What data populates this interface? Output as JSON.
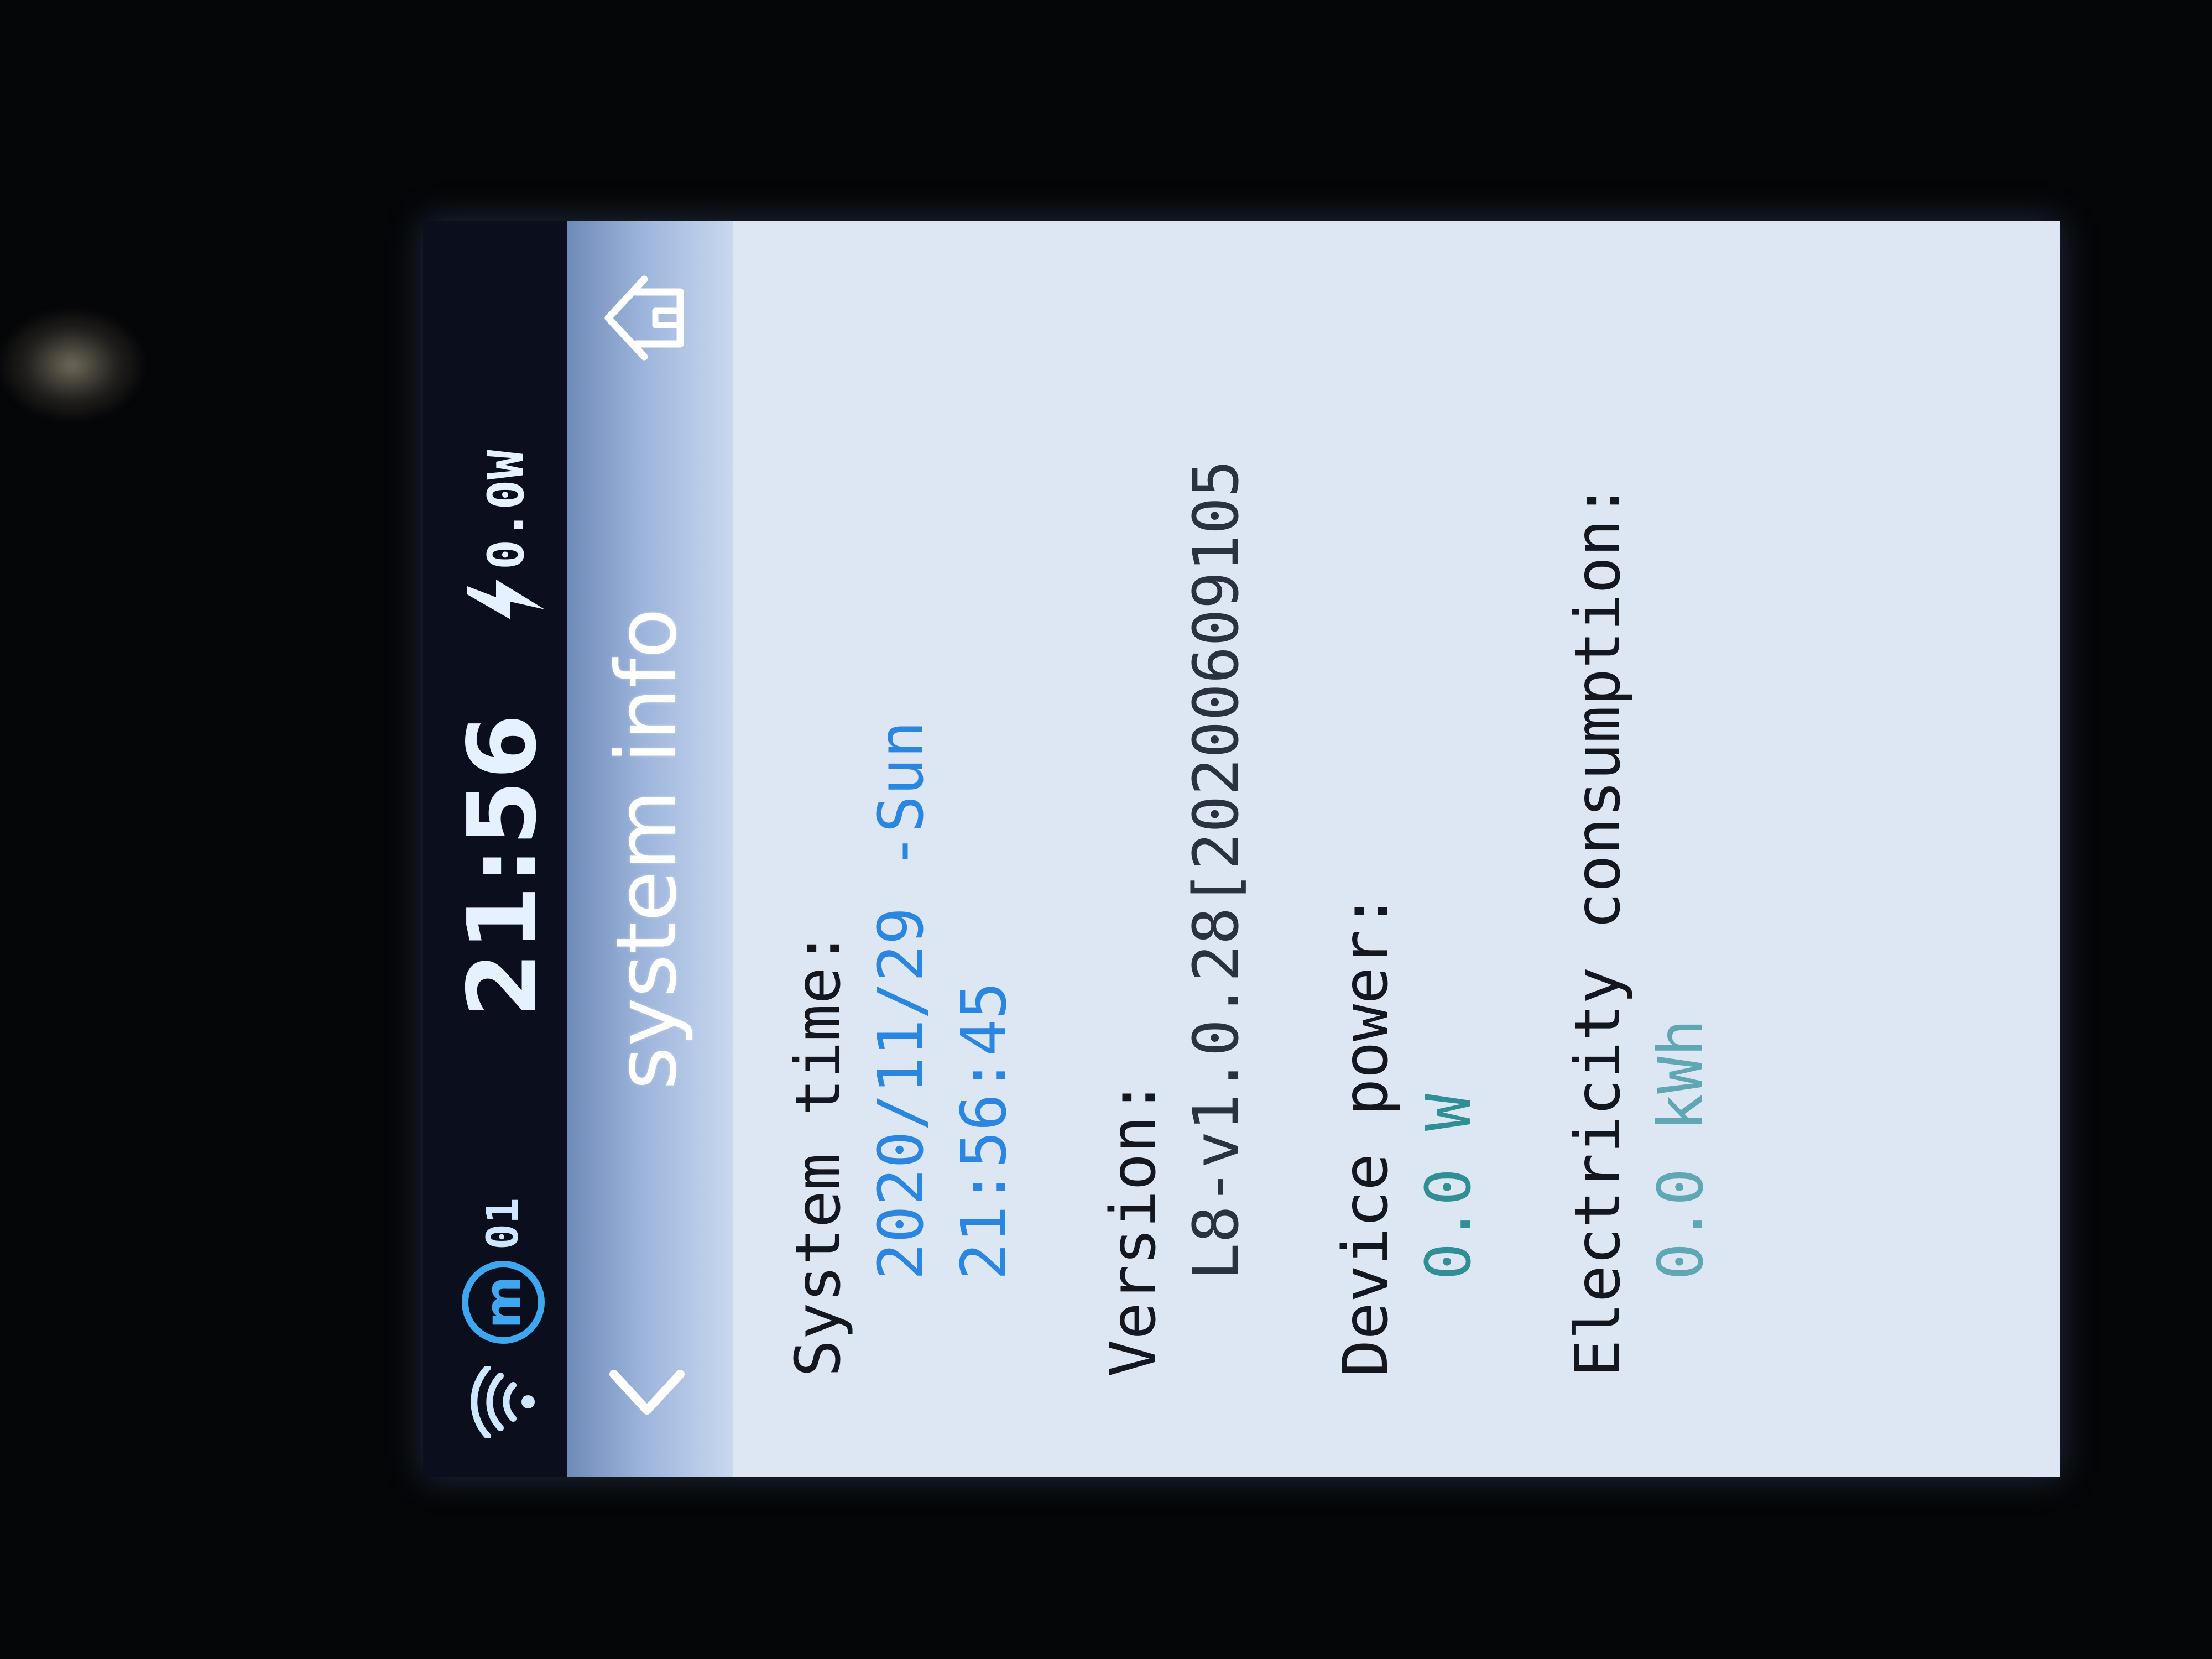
{
  "status_bar": {
    "station_id": "01",
    "time": "21:56",
    "power": "0.0W",
    "icons": {
      "wifi": "wifi-icon",
      "brand": "m-logo-icon",
      "power": "lightning-bolt-icon"
    }
  },
  "title_bar": {
    "title": "system info",
    "back_icon": "chevron-left-icon",
    "home_icon": "home-icon"
  },
  "info": {
    "system_time": {
      "label": "System time:",
      "date": "2020/11/29 -Sun",
      "time": "21:56:45"
    },
    "version": {
      "label": "Version:",
      "value": "L8-v1.0.28[20200609105"
    },
    "device_power": {
      "label": "Device power:",
      "value": "0.0 W"
    },
    "electricity": {
      "label": "Electricity consumption:",
      "value": "0.0 kWh"
    }
  },
  "colors": {
    "status_bg": "#0b0f1d",
    "screen_bg": "#dde6f3",
    "accent_blue": "#2a86e0",
    "value_teal": "#2f8f94",
    "label_text": "#14171d"
  }
}
